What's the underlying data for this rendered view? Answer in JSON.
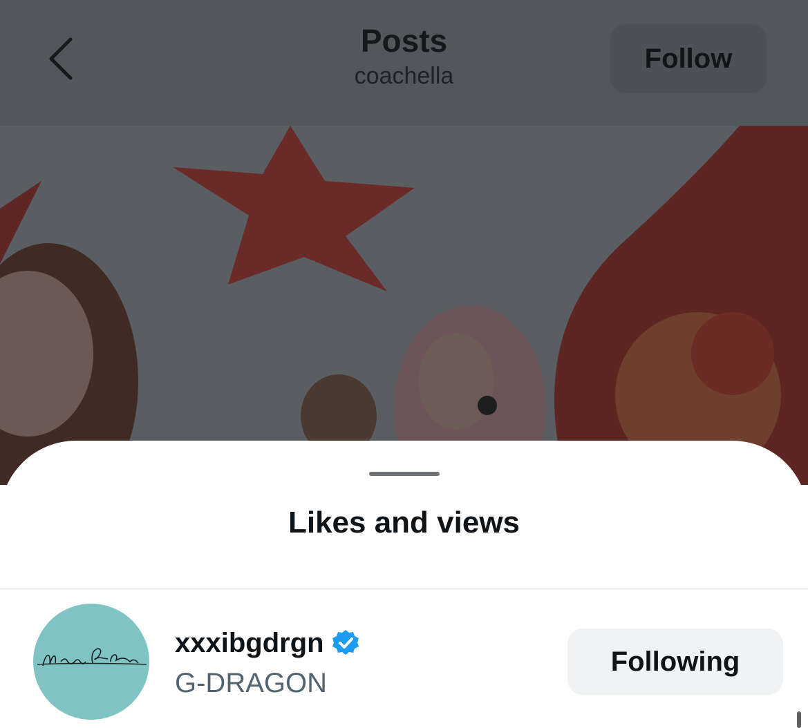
{
  "header": {
    "back_icon": "chevron-left-icon",
    "title": "Posts",
    "subtitle": "coachella",
    "follow_label": "Follow"
  },
  "sheet": {
    "title": "Likes and views",
    "users": [
      {
        "username": "xxxibgdrgn",
        "verified": true,
        "verified_color": "#1d9bf0",
        "display_name": "G-DRAGON",
        "action_label": "Following",
        "avatar_signature": "Monsieur G-Dragon"
      }
    ]
  },
  "colors": {
    "overlay": "#52575c",
    "verified": "#1d9bf0",
    "button_bg": "#eff3f4",
    "secondary_text": "#536471"
  }
}
